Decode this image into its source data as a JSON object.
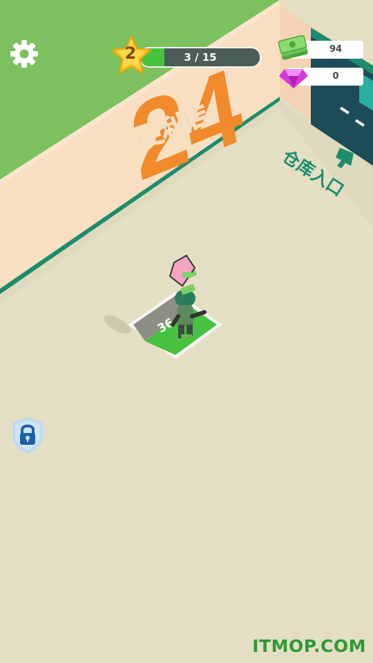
{
  "hud": {
    "settings_icon": "gear-icon",
    "level": {
      "number": "2",
      "progress_text": "3 / 15",
      "progress_fraction": 0.2
    },
    "currencies": {
      "cash": {
        "icon": "cash-stack-icon",
        "value": "94"
      },
      "gems": {
        "icon": "gem-icon",
        "value": "0"
      }
    },
    "lock_icon": "lock-shield-icon"
  },
  "scene": {
    "store_sign": {
      "big_number": "24",
      "name": "便利店"
    },
    "warehouse_label": "仓库入口",
    "purchase_pad_price": "36",
    "colors": {
      "grass": "#7cc15e",
      "wall": "#f8dfc2",
      "floor": "#e4dfc4",
      "accent_green": "#1d8c6c",
      "sign_red": "#e6312c",
      "sign_orange": "#f08a2a",
      "pad_green": "#46c240"
    }
  },
  "watermark": "ITMOP.COM"
}
